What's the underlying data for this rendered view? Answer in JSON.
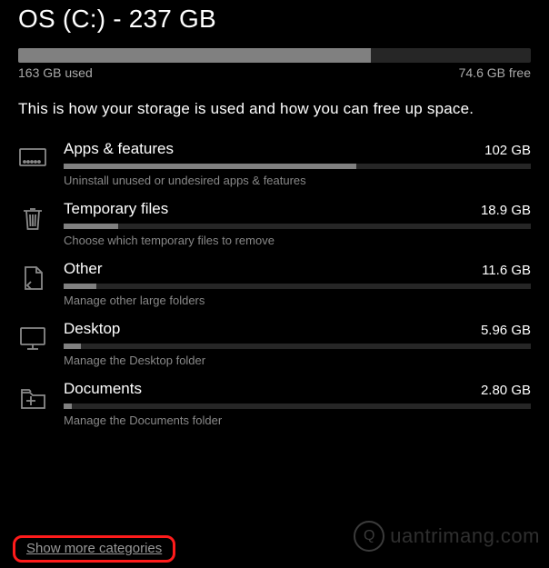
{
  "drive": {
    "title": "OS (C:) - 237 GB",
    "used_label": "163 GB used",
    "free_label": "74.6 GB free",
    "used_gb": 163,
    "free_gb": 74.6,
    "used_pct": 68.8,
    "intro": "This is how your storage is used and how you can free up space."
  },
  "categories": [
    {
      "id": "apps-features",
      "name": "Apps & features",
      "size": "102 GB",
      "desc": "Uninstall unused or undesired apps & features",
      "fill_pct": 62.6,
      "icon": "apps"
    },
    {
      "id": "temporary-files",
      "name": "Temporary files",
      "size": "18.9 GB",
      "desc": "Choose which temporary files to remove",
      "fill_pct": 11.6,
      "icon": "trash"
    },
    {
      "id": "other",
      "name": "Other",
      "size": "11.6 GB",
      "desc": "Manage other large folders",
      "fill_pct": 7.1,
      "icon": "other"
    },
    {
      "id": "desktop",
      "name": "Desktop",
      "size": "5.96 GB",
      "desc": "Manage the Desktop folder",
      "fill_pct": 3.66,
      "icon": "desktop"
    },
    {
      "id": "documents",
      "name": "Documents",
      "size": "2.80 GB",
      "desc": "Manage the Documents folder",
      "fill_pct": 1.72,
      "icon": "documents"
    }
  ],
  "show_more_label": "Show more categories",
  "watermark": {
    "text": "uantrimang.com",
    "bulb": "Q"
  },
  "icons_svg": {
    "apps": "<svg viewBox='0 0 32 32' fill='none' stroke='currentColor' stroke-width='1.8'><rect x='2' y='6' width='28' height='18' rx='1'/><circle cx='7' cy='20' r='1' fill='currentColor'/><circle cx='11' cy='20' r='1' fill='currentColor'/><circle cx='15' cy='20' r='1' fill='currentColor'/><circle cx='19' cy='20' r='1' fill='currentColor'/><circle cx='23' cy='20' r='1' fill='currentColor'/></svg>",
    "trash": "<svg viewBox='0 0 32 32' fill='none' stroke='currentColor' stroke-width='1.8'><path d='M6 8h20'/><path d='M9 8l1.5 20h11L23 8'/><path d='M13 6h6'/><line x1='13' y1='12' x2='13.5' y2='25'/><line x1='16' y1='12' x2='16' y2='25'/><line x1='19' y1='12' x2='18.5' y2='25'/></svg>",
    "other": "<svg viewBox='0 0 32 32' fill='none' stroke='currentColor' stroke-width='1.8'><path d='M8 4h12l6 6v18H8z'/><path d='M20 4v6h6'/><path d='M14 28l-4-4 4-4'/></svg>",
    "desktop": "<svg viewBox='0 0 32 32' fill='none' stroke='currentColor' stroke-width='1.8'><rect x='3' y='5' width='26' height='18' rx='1'/><line x1='10' y1='28' x2='22' y2='28'/><line x1='16' y1='23' x2='16' y2='28'/></svg>",
    "documents": "<svg viewBox='0 0 32 32' fill='none' stroke='currentColor' stroke-width='1.8'><path d='M4 10h9l3 3h13v14H4z'/><path d='M4 10V7h8l2 2'/><line x1='14' y1='14' x2='14' y2='24'/><line x1='9' y1='19' x2='19' y2='19'/></svg>"
  },
  "chart_data": {
    "type": "bar",
    "title": "Storage usage breakdown (GB of 237 GB used)",
    "categories": [
      "Apps & features",
      "Temporary files",
      "Other",
      "Desktop",
      "Documents"
    ],
    "values": [
      102,
      18.9,
      11.6,
      5.96,
      2.8
    ],
    "total_gb": 237,
    "used_gb": 163,
    "free_gb": 74.6,
    "xlabel": "",
    "ylabel": "GB",
    "ylim": [
      0,
      237
    ]
  }
}
